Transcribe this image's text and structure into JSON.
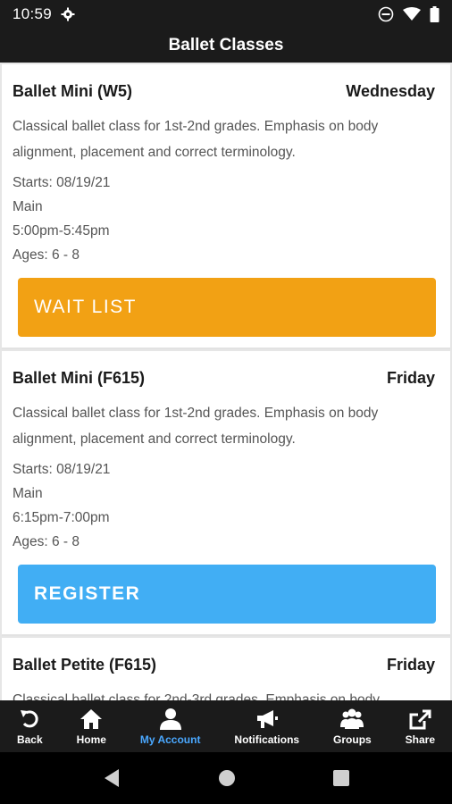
{
  "status_bar": {
    "time": "10:59"
  },
  "header": {
    "title": "Ballet Classes"
  },
  "classes": [
    {
      "name": "Ballet Mini (W5)",
      "day": "Wednesday",
      "description": "Classical ballet class for 1st-2nd grades. Emphasis on body alignment, placement and correct terminology.",
      "starts": "Starts: 08/19/21",
      "location": "Main",
      "time": "5:00pm-5:45pm",
      "ages": "Ages: 6 - 8",
      "button_label": "WAIT LIST",
      "button_color": "#f2a114"
    },
    {
      "name": "Ballet Mini (F615)",
      "day": "Friday",
      "description": "Classical ballet class for 1st-2nd grades. Emphasis on body alignment, placement and correct terminology.",
      "starts": "Starts: 08/19/21",
      "location": "Main",
      "time": "6:15pm-7:00pm",
      "ages": "Ages: 6 - 8",
      "button_label": "REGISTER",
      "button_color": "#41aef4"
    },
    {
      "name": "Ballet Petite (F615)",
      "day": "Friday",
      "description": "Classical ballet class for 2nd-3rd grades. Emphasis on body"
    }
  ],
  "tabs": [
    {
      "label": "Back",
      "icon": "back-arrow-icon"
    },
    {
      "label": "Home",
      "icon": "home-icon"
    },
    {
      "label": "My Account",
      "icon": "person-icon",
      "active": true
    },
    {
      "label": "Notifications",
      "icon": "megaphone-icon"
    },
    {
      "label": "Groups",
      "icon": "groups-icon"
    },
    {
      "label": "Share",
      "icon": "share-icon"
    }
  ],
  "colors": {
    "bar": "#1b1b1b",
    "active_tab": "#4aa8ff",
    "wait_list": "#f2a114",
    "register": "#41aef4"
  }
}
